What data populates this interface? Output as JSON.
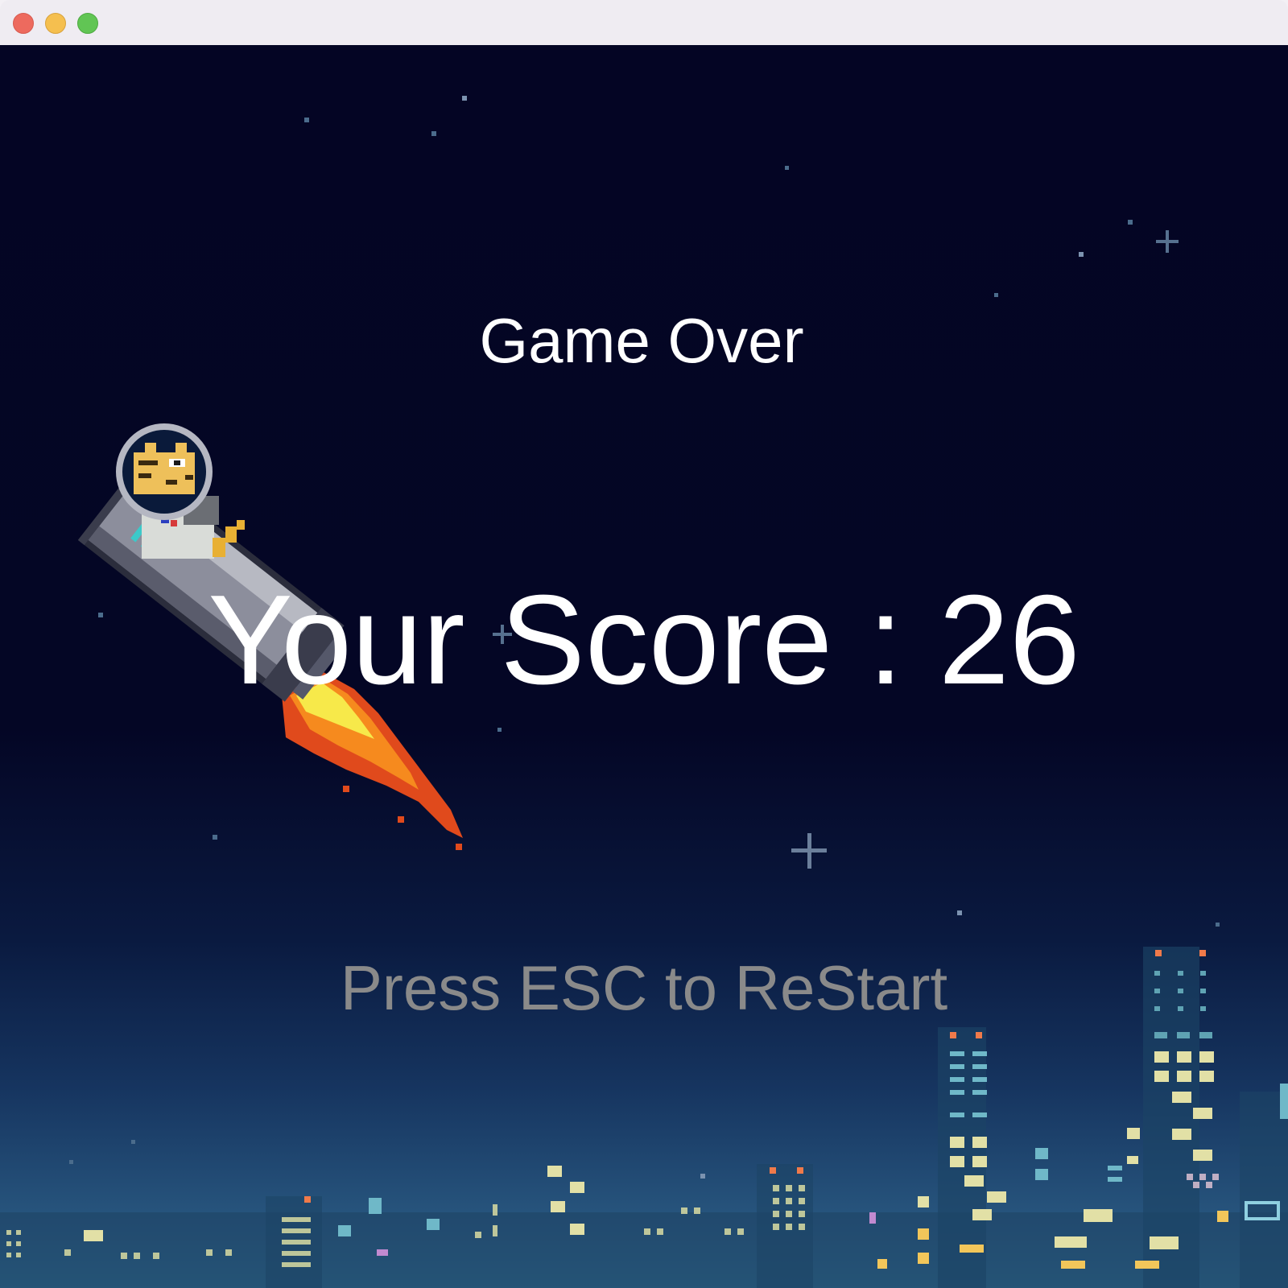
{
  "window": {
    "controls": [
      "close",
      "minimize",
      "maximize"
    ]
  },
  "game": {
    "title_text": "Game Over",
    "score_label": "Your Score",
    "score_separator": ":",
    "score_value": "26",
    "restart_prompt": "Press ESC to ReStart"
  },
  "sprites": {
    "player": "astronaut-cat-riding-rocket-icon",
    "background": "night-city-skyline"
  },
  "colors": {
    "sky_top": "#040524",
    "sky_bottom": "#2f6a8e",
    "primary_text": "#ffffff",
    "prompt_text": "#8a8a8a",
    "flame": "#f05a1e"
  }
}
